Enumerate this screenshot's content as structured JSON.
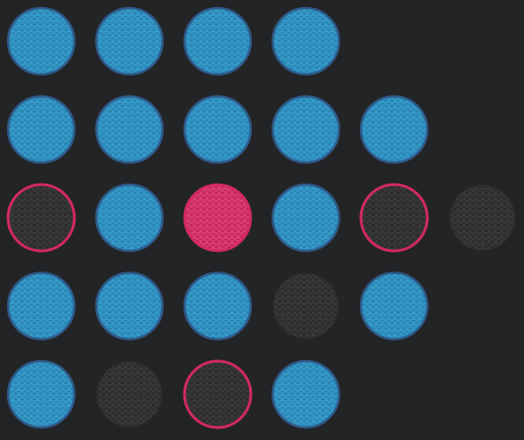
{
  "colors": {
    "background": "#232426",
    "filled_blue": "#2a86b4",
    "filled_blue_rim": "#2f5a8a",
    "filled_blue_hex": "#3aa0cf",
    "filled_pink": "#c8285c",
    "filled_pink_hex": "#e0457c",
    "empty_fill": "#2c2c2e",
    "empty_hex": "#3c3c3e",
    "outline_pink": "#d12a5e"
  },
  "grid": {
    "rows": 5,
    "cols": 6,
    "cells": [
      [
        "blue",
        "blue",
        "blue",
        "blue",
        "none",
        "none"
      ],
      [
        "blue",
        "blue",
        "blue",
        "blue",
        "blue",
        "none"
      ],
      [
        "outline",
        "blue",
        "pink",
        "blue",
        "outline",
        "empty"
      ],
      [
        "blue",
        "blue",
        "blue",
        "empty",
        "blue",
        "none"
      ],
      [
        "blue",
        "empty",
        "outline",
        "blue",
        "none",
        "none"
      ]
    ]
  }
}
